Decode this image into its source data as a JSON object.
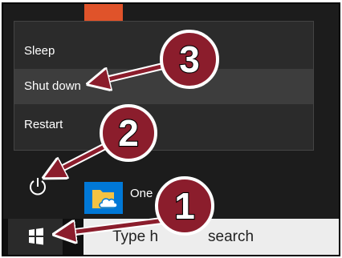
{
  "menu": {
    "items": [
      {
        "label": "Sleep"
      },
      {
        "label": "Shut down"
      },
      {
        "label": "Restart"
      }
    ]
  },
  "icons": {
    "power": "power-icon",
    "windows": "windows-logo-icon",
    "onedrive": "onedrive-folder-icon"
  },
  "app": {
    "label": "One"
  },
  "search": {
    "placeholder_left": "Type h",
    "placeholder_right": "search"
  },
  "callouts": [
    {
      "number": "1",
      "target": "start-button"
    },
    {
      "number": "2",
      "target": "power-button"
    },
    {
      "number": "3",
      "target": "shut-down-item"
    }
  ],
  "colors": {
    "callout_fill": "#8b1d2c",
    "menu_bg": "#2b2b2b",
    "accent_orange": "#e0532a",
    "accent_blue": "#0078d7"
  }
}
